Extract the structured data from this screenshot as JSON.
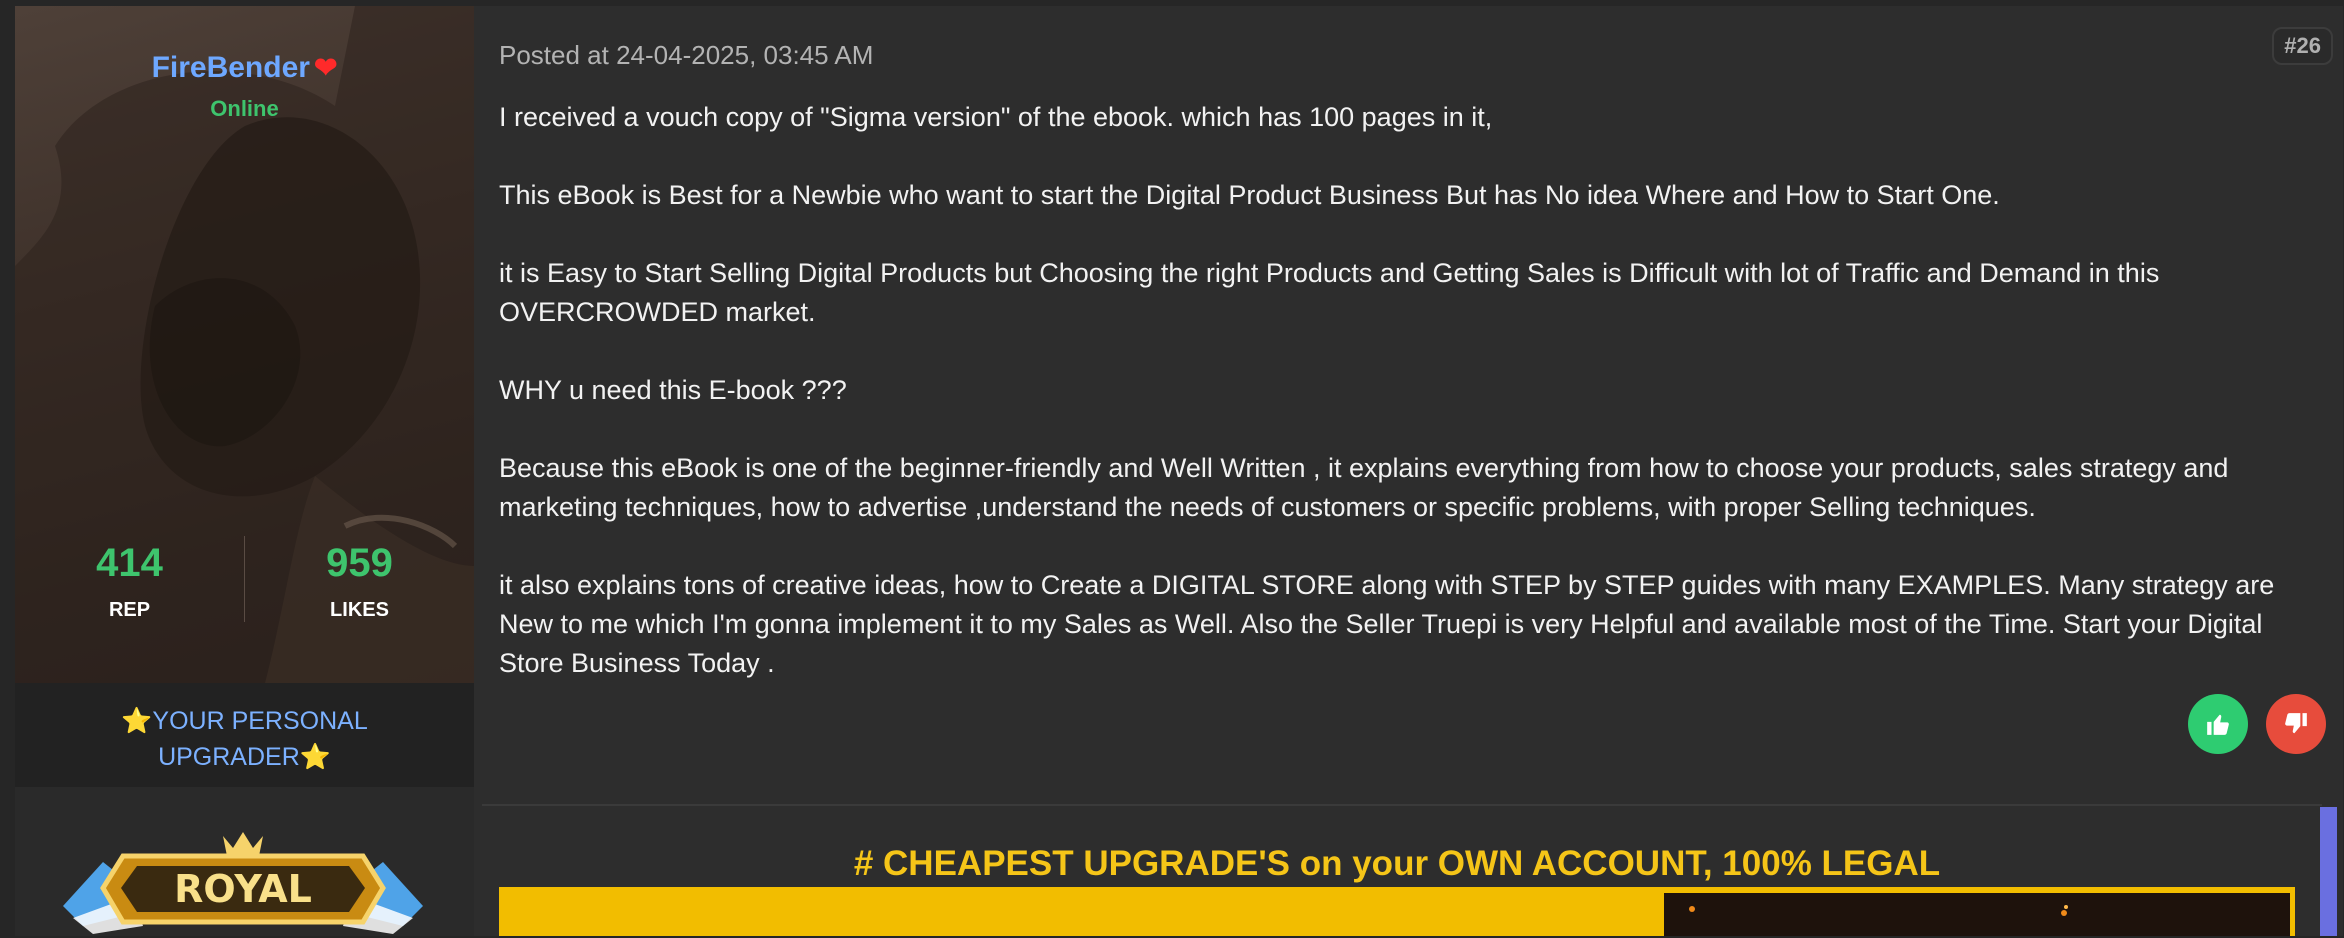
{
  "user": {
    "name": "FireBender",
    "status": "Online",
    "stats": [
      {
        "value": "414",
        "label": "REP"
      },
      {
        "value": "959",
        "label": "LIKES"
      }
    ],
    "title_line1": "YOUR PERSONAL",
    "title_line2": "UPGRADER",
    "badge": "ROYAL"
  },
  "post": {
    "posted_at": "Posted at 24-04-2025, 03:45 AM",
    "number": "#26",
    "paragraphs": [
      "I received a vouch copy of \"Sigma version\" of the ebook. which has 100 pages in it,",
      "This eBook is Best for a Newbie who want to start the Digital Product Business But has No idea Where and How to Start One.",
      "it is Easy to Start Selling Digital Products but Choosing the right Products and Getting Sales is Difficult with lot of Traffic and Demand in this OVERCROWDED market.",
      "WHY u need this E-book ???",
      "Because this eBook is one of the beginner-friendly and Well Written , it explains everything from how to choose your products, sales strategy and marketing techniques, how to advertise ,understand  the needs of customers or specific problems, with proper Selling techniques.",
      "it also explains tons of creative ideas, how to Create a DIGITAL STORE along with STEP by STEP guides with many EXAMPLES. Many strategy are New to me which I'm gonna implement it to my Sales as Well. Also the Seller Truepi is very Helpful and available most of the Time. Start your Digital Store Business Today ."
    ]
  },
  "signature": {
    "headline": "# CHEAPEST UPGRADE'S on your OWN ACCOUNT, 100% LEGAL"
  },
  "icons": {
    "heart": "heart-icon",
    "star": "star-icon",
    "thumbs_up": "thumbs-up-icon",
    "thumbs_down": "thumbs-down-icon"
  },
  "colors": {
    "username": "#6ea8ff",
    "online": "#3ec46d",
    "rep_likes": "#3ec46d",
    "like_button": "#2ecc71",
    "dislike_button": "#e74c3c",
    "signature_headline": "#f5c518",
    "signature_banner": "#f2bd00"
  }
}
